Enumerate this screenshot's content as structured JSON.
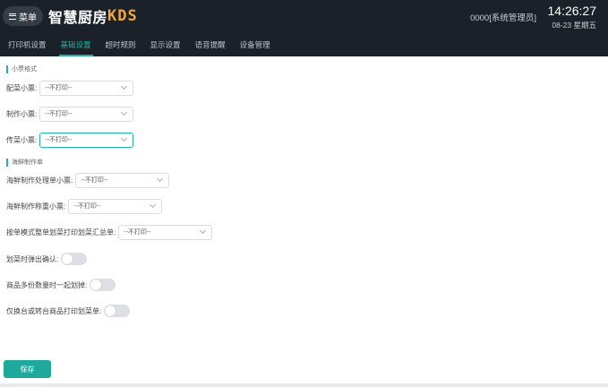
{
  "header": {
    "menu_label": "菜单",
    "app_title_cn": "智慧厨房",
    "app_title_en": "KDS",
    "user": "0000[系统管理员]",
    "time": "14:26:27",
    "date": "08-23 星期五"
  },
  "tabs": [
    {
      "label": "打印机设置",
      "active": false
    },
    {
      "label": "基础设置",
      "active": true
    },
    {
      "label": "超时规则",
      "active": false
    },
    {
      "label": "显示设置",
      "active": false
    },
    {
      "label": "语音提醒",
      "active": false
    },
    {
      "label": "设备管理",
      "active": false
    }
  ],
  "section1": {
    "title": "小票格式",
    "fields": [
      {
        "label": "配菜小票:",
        "value": "--不打印--"
      },
      {
        "label": "制作小票:",
        "value": "--不打印--"
      },
      {
        "label": "传菜小票:",
        "value": "--不打印--"
      }
    ]
  },
  "section2": {
    "title": "海鲜制作单",
    "fields": [
      {
        "label": "海鲜制作处理单小票:",
        "value": "--不打印--"
      },
      {
        "label": "海鲜制作称重小票:",
        "value": "--不打印--"
      },
      {
        "label": "按单模式整单划菜打印划菜汇总单:",
        "value": "--不打印--"
      }
    ]
  },
  "toggles": [
    {
      "label": "划菜时弹出确认:",
      "on": false
    },
    {
      "label": "商品多份数量时一起划掉:",
      "on": false
    },
    {
      "label": "仅换台或转台商品打印划菜单:",
      "on": false
    }
  ],
  "save_label": "保存",
  "colors": {
    "accent": "#23b1a4",
    "header_bg": "#1b2129",
    "logo_en": "#f0a63a"
  }
}
